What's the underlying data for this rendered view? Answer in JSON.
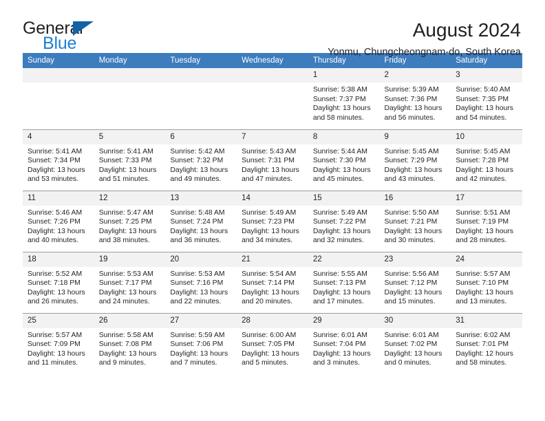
{
  "brand": {
    "name_part1": "General",
    "name_part2": "Blue",
    "triangle_color": "#1362a5",
    "blue_color": "#1b7fd4"
  },
  "header": {
    "title": "August 2024",
    "subtitle": "Yonmu, Chungcheongnam-do, South Korea"
  },
  "theme": {
    "header_row_bg": "#3d7cbd",
    "daynum_bg": "#f2f2f2",
    "grid_line": "#9d9d9d",
    "text": "#231f20"
  },
  "weekdays": [
    "Sunday",
    "Monday",
    "Tuesday",
    "Wednesday",
    "Thursday",
    "Friday",
    "Saturday"
  ],
  "weeks": [
    [
      {
        "day": "",
        "sunrise": "",
        "sunset": "",
        "daylight1": "",
        "daylight2": ""
      },
      {
        "day": "",
        "sunrise": "",
        "sunset": "",
        "daylight1": "",
        "daylight2": ""
      },
      {
        "day": "",
        "sunrise": "",
        "sunset": "",
        "daylight1": "",
        "daylight2": ""
      },
      {
        "day": "",
        "sunrise": "",
        "sunset": "",
        "daylight1": "",
        "daylight2": ""
      },
      {
        "day": "1",
        "sunrise": "Sunrise: 5:38 AM",
        "sunset": "Sunset: 7:37 PM",
        "daylight1": "Daylight: 13 hours",
        "daylight2": "and 58 minutes."
      },
      {
        "day": "2",
        "sunrise": "Sunrise: 5:39 AM",
        "sunset": "Sunset: 7:36 PM",
        "daylight1": "Daylight: 13 hours",
        "daylight2": "and 56 minutes."
      },
      {
        "day": "3",
        "sunrise": "Sunrise: 5:40 AM",
        "sunset": "Sunset: 7:35 PM",
        "daylight1": "Daylight: 13 hours",
        "daylight2": "and 54 minutes."
      }
    ],
    [
      {
        "day": "4",
        "sunrise": "Sunrise: 5:41 AM",
        "sunset": "Sunset: 7:34 PM",
        "daylight1": "Daylight: 13 hours",
        "daylight2": "and 53 minutes."
      },
      {
        "day": "5",
        "sunrise": "Sunrise: 5:41 AM",
        "sunset": "Sunset: 7:33 PM",
        "daylight1": "Daylight: 13 hours",
        "daylight2": "and 51 minutes."
      },
      {
        "day": "6",
        "sunrise": "Sunrise: 5:42 AM",
        "sunset": "Sunset: 7:32 PM",
        "daylight1": "Daylight: 13 hours",
        "daylight2": "and 49 minutes."
      },
      {
        "day": "7",
        "sunrise": "Sunrise: 5:43 AM",
        "sunset": "Sunset: 7:31 PM",
        "daylight1": "Daylight: 13 hours",
        "daylight2": "and 47 minutes."
      },
      {
        "day": "8",
        "sunrise": "Sunrise: 5:44 AM",
        "sunset": "Sunset: 7:30 PM",
        "daylight1": "Daylight: 13 hours",
        "daylight2": "and 45 minutes."
      },
      {
        "day": "9",
        "sunrise": "Sunrise: 5:45 AM",
        "sunset": "Sunset: 7:29 PM",
        "daylight1": "Daylight: 13 hours",
        "daylight2": "and 43 minutes."
      },
      {
        "day": "10",
        "sunrise": "Sunrise: 5:45 AM",
        "sunset": "Sunset: 7:28 PM",
        "daylight1": "Daylight: 13 hours",
        "daylight2": "and 42 minutes."
      }
    ],
    [
      {
        "day": "11",
        "sunrise": "Sunrise: 5:46 AM",
        "sunset": "Sunset: 7:26 PM",
        "daylight1": "Daylight: 13 hours",
        "daylight2": "and 40 minutes."
      },
      {
        "day": "12",
        "sunrise": "Sunrise: 5:47 AM",
        "sunset": "Sunset: 7:25 PM",
        "daylight1": "Daylight: 13 hours",
        "daylight2": "and 38 minutes."
      },
      {
        "day": "13",
        "sunrise": "Sunrise: 5:48 AM",
        "sunset": "Sunset: 7:24 PM",
        "daylight1": "Daylight: 13 hours",
        "daylight2": "and 36 minutes."
      },
      {
        "day": "14",
        "sunrise": "Sunrise: 5:49 AM",
        "sunset": "Sunset: 7:23 PM",
        "daylight1": "Daylight: 13 hours",
        "daylight2": "and 34 minutes."
      },
      {
        "day": "15",
        "sunrise": "Sunrise: 5:49 AM",
        "sunset": "Sunset: 7:22 PM",
        "daylight1": "Daylight: 13 hours",
        "daylight2": "and 32 minutes."
      },
      {
        "day": "16",
        "sunrise": "Sunrise: 5:50 AM",
        "sunset": "Sunset: 7:21 PM",
        "daylight1": "Daylight: 13 hours",
        "daylight2": "and 30 minutes."
      },
      {
        "day": "17",
        "sunrise": "Sunrise: 5:51 AM",
        "sunset": "Sunset: 7:19 PM",
        "daylight1": "Daylight: 13 hours",
        "daylight2": "and 28 minutes."
      }
    ],
    [
      {
        "day": "18",
        "sunrise": "Sunrise: 5:52 AM",
        "sunset": "Sunset: 7:18 PM",
        "daylight1": "Daylight: 13 hours",
        "daylight2": "and 26 minutes."
      },
      {
        "day": "19",
        "sunrise": "Sunrise: 5:53 AM",
        "sunset": "Sunset: 7:17 PM",
        "daylight1": "Daylight: 13 hours",
        "daylight2": "and 24 minutes."
      },
      {
        "day": "20",
        "sunrise": "Sunrise: 5:53 AM",
        "sunset": "Sunset: 7:16 PM",
        "daylight1": "Daylight: 13 hours",
        "daylight2": "and 22 minutes."
      },
      {
        "day": "21",
        "sunrise": "Sunrise: 5:54 AM",
        "sunset": "Sunset: 7:14 PM",
        "daylight1": "Daylight: 13 hours",
        "daylight2": "and 20 minutes."
      },
      {
        "day": "22",
        "sunrise": "Sunrise: 5:55 AM",
        "sunset": "Sunset: 7:13 PM",
        "daylight1": "Daylight: 13 hours",
        "daylight2": "and 17 minutes."
      },
      {
        "day": "23",
        "sunrise": "Sunrise: 5:56 AM",
        "sunset": "Sunset: 7:12 PM",
        "daylight1": "Daylight: 13 hours",
        "daylight2": "and 15 minutes."
      },
      {
        "day": "24",
        "sunrise": "Sunrise: 5:57 AM",
        "sunset": "Sunset: 7:10 PM",
        "daylight1": "Daylight: 13 hours",
        "daylight2": "and 13 minutes."
      }
    ],
    [
      {
        "day": "25",
        "sunrise": "Sunrise: 5:57 AM",
        "sunset": "Sunset: 7:09 PM",
        "daylight1": "Daylight: 13 hours",
        "daylight2": "and 11 minutes."
      },
      {
        "day": "26",
        "sunrise": "Sunrise: 5:58 AM",
        "sunset": "Sunset: 7:08 PM",
        "daylight1": "Daylight: 13 hours",
        "daylight2": "and 9 minutes."
      },
      {
        "day": "27",
        "sunrise": "Sunrise: 5:59 AM",
        "sunset": "Sunset: 7:06 PM",
        "daylight1": "Daylight: 13 hours",
        "daylight2": "and 7 minutes."
      },
      {
        "day": "28",
        "sunrise": "Sunrise: 6:00 AM",
        "sunset": "Sunset: 7:05 PM",
        "daylight1": "Daylight: 13 hours",
        "daylight2": "and 5 minutes."
      },
      {
        "day": "29",
        "sunrise": "Sunrise: 6:01 AM",
        "sunset": "Sunset: 7:04 PM",
        "daylight1": "Daylight: 13 hours",
        "daylight2": "and 3 minutes."
      },
      {
        "day": "30",
        "sunrise": "Sunrise: 6:01 AM",
        "sunset": "Sunset: 7:02 PM",
        "daylight1": "Daylight: 13 hours",
        "daylight2": "and 0 minutes."
      },
      {
        "day": "31",
        "sunrise": "Sunrise: 6:02 AM",
        "sunset": "Sunset: 7:01 PM",
        "daylight1": "Daylight: 12 hours",
        "daylight2": "and 58 minutes."
      }
    ]
  ]
}
